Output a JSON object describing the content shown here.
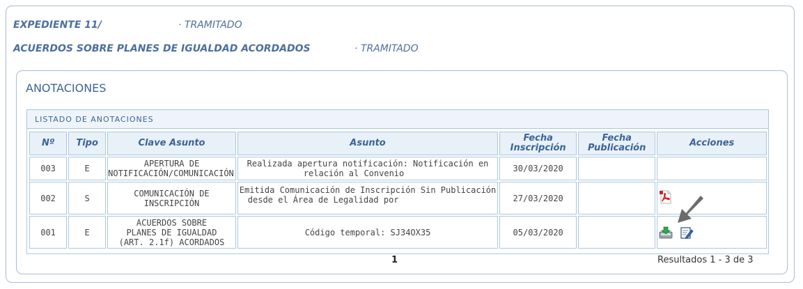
{
  "expediente": {
    "line1_label": "EXPEDIENTE 11/",
    "line1_status": "· TRAMITADO",
    "line2_label": "ACUERDOS SOBRE PLANES DE IGUALDAD ACORDADOS",
    "line2_status": "· TRAMITADO"
  },
  "anotaciones": {
    "title": "ANOTACIONES",
    "listado_title": "LISTADO DE ANOTACIONES",
    "headers": {
      "numero": "Nº",
      "tipo": "Tipo",
      "clave": "Clave Asunto",
      "asunto": "Asunto",
      "fecha_insc_1": "Fecha",
      "fecha_insc_2": "Inscripción",
      "fecha_pub_1": "Fecha",
      "fecha_pub_2": "Publicación",
      "acciones": "Acciones"
    },
    "rows": [
      {
        "numero": "003",
        "tipo": "E",
        "clave_1": "APERTURA DE",
        "clave_2": "NOTIFICACIÓN/COMUNICACIÓN",
        "asunto_1": "Realizada apertura notificación: Notificación en",
        "asunto_2": "relación al Convenio",
        "fecha_inscripcion": "30/03/2020",
        "fecha_publicacion": "",
        "acciones": []
      },
      {
        "numero": "002",
        "tipo": "S",
        "clave_1": "COMUNICACIÓN DE",
        "clave_2": "INSCRIPCIÓN",
        "asunto_1": "Emitida Comunicación de Inscripción Sin Publicación",
        "asunto_2": "desde el Área de Legalidad por",
        "fecha_inscripcion": "27/03/2020",
        "fecha_publicacion": "",
        "acciones": [
          "pdf-icon"
        ]
      },
      {
        "numero": "001",
        "tipo": "E",
        "clave_1": "ACUERDOS SOBRE",
        "clave_2": "PLANES DE IGUALDAD",
        "clave_3": "(ART. 2.1f) ACORDADOS",
        "asunto_1": "Código temporal: SJ34OX35",
        "fecha_inscripcion": "05/03/2020",
        "fecha_publicacion": "",
        "acciones": [
          "download-icon",
          "edit-document-icon"
        ]
      }
    ],
    "pager": "1",
    "results": "Resultados 1 - 3 de 3"
  },
  "colors": {
    "heading_blue": "#4d6f9c",
    "border_blue": "#a9c7e0",
    "header_bg": "#e8f0f8"
  }
}
